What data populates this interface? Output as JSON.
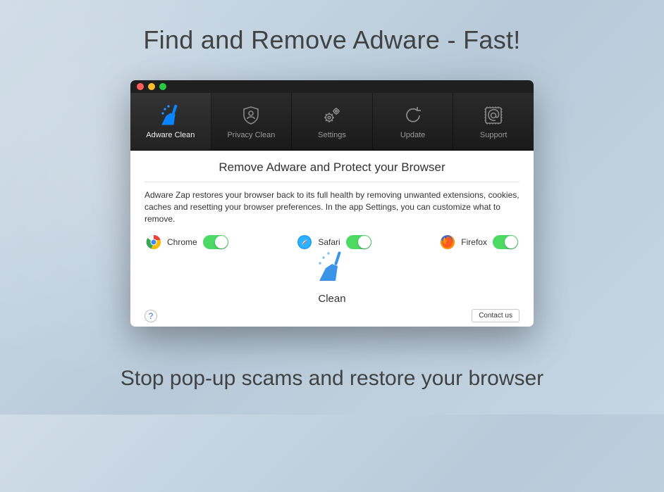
{
  "marketing": {
    "headline_top": "Find and Remove Adware - Fast!",
    "headline_bottom": "Stop pop-up scams and restore your browser"
  },
  "toolbar": {
    "items": [
      {
        "label": "Adware Clean",
        "icon": "broom-icon",
        "active": true
      },
      {
        "label": "Privacy Clean",
        "icon": "privacy-shield-icon",
        "active": false
      },
      {
        "label": "Settings",
        "icon": "gears-icon",
        "active": false
      },
      {
        "label": "Update",
        "icon": "refresh-icon",
        "active": false
      },
      {
        "label": "Support",
        "icon": "support-at-icon",
        "active": false
      }
    ]
  },
  "panel": {
    "title": "Remove Adware and Protect your Browser",
    "description": "Adware Zap restores your browser back to its full health by removing unwanted extensions, cookies, caches and resetting your browser preferences. In the app Settings, you can customize what to remove.",
    "browsers": [
      {
        "name": "Chrome",
        "enabled": true
      },
      {
        "name": "Safari",
        "enabled": true
      },
      {
        "name": "Firefox",
        "enabled": true
      }
    ],
    "action_label": "Clean",
    "help_label": "?",
    "contact_label": "Contact us"
  }
}
